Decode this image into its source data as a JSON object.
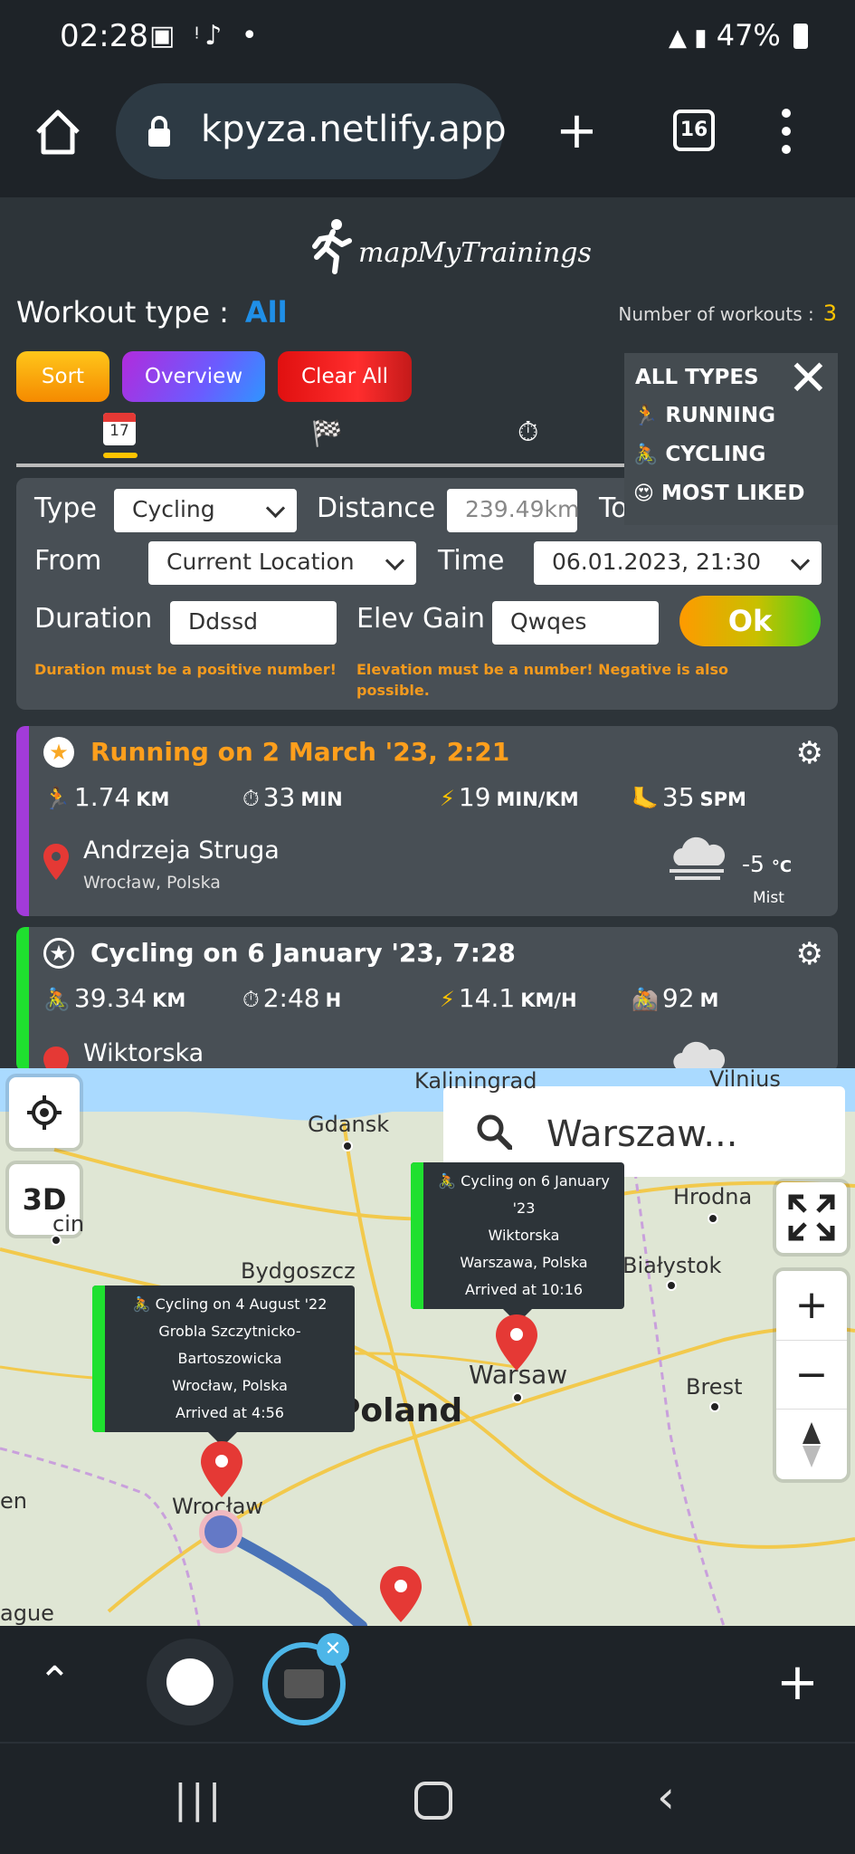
{
  "status_bar": {
    "time": "02:28",
    "battery": "47%"
  },
  "browser": {
    "url": "kpyza.netlify.app",
    "tab_count": "16"
  },
  "app": {
    "logo_text": "mapMyTrainings",
    "workout_type_label": "Workout type :",
    "workout_type_value": "All",
    "workout_count_label": "Number of workouts :",
    "workout_count": "3",
    "buttons": {
      "sort": "Sort",
      "overview": "Overview",
      "clear_all": "Clear All"
    },
    "calendar_day": "17"
  },
  "type_dropdown": {
    "title": "ALL TYPES",
    "items": [
      {
        "icon": "🏃",
        "label": "RUNNING"
      },
      {
        "icon": "🚴",
        "label": "CYCLING"
      },
      {
        "icon": "😍",
        "label": "MOST LIKED"
      }
    ]
  },
  "form": {
    "type_label": "Type",
    "type_value": "Cycling",
    "distance_label": "Distance",
    "distance_value": "239.49km",
    "to_label": "To",
    "from_label": "From",
    "from_value": "Current Location",
    "time_label": "Time",
    "time_value": "06.01.2023, 21:30",
    "duration_label": "Duration",
    "duration_value": "Ddssd",
    "elev_label": "Elev Gain",
    "elev_value": "Qwqes",
    "ok_label": "Ok",
    "duration_error": "Duration must be a positive number!",
    "elev_error_line1": "Elevation must be a number! Negative is also",
    "elev_error_line2": "possible."
  },
  "workouts": [
    {
      "title": "Running on 2 March '23, 2:21",
      "title_color": "#ff9f1c",
      "stripe_color": "#a23bd9",
      "stats": [
        {
          "icon": "🏃",
          "value": "1.74",
          "unit": "KM"
        },
        {
          "icon": "⏱",
          "value": "33",
          "unit": "MIN"
        },
        {
          "icon": "⚡",
          "value": "19",
          "unit": "MIN/KM"
        },
        {
          "icon": "🦶",
          "value": "35",
          "unit": "SPM"
        }
      ],
      "street": "Andrzeja Struga",
      "city": "Wrocław, Polska",
      "temp": "-5",
      "temp_unit": "°C",
      "weather": "Mist"
    },
    {
      "title": "Cycling on 6 January '23, 7:28",
      "title_color": "#ffffff",
      "stripe_color": "#1fe02f",
      "stats": [
        {
          "icon": "🚴",
          "value": "39.34",
          "unit": "KM"
        },
        {
          "icon": "⏱",
          "value": "2:48",
          "unit": "H"
        },
        {
          "icon": "⚡",
          "value": "14.1",
          "unit": "KM/H"
        },
        {
          "icon": "🚵",
          "value": "92",
          "unit": "M"
        }
      ],
      "street": "Wiktorska"
    }
  ],
  "map": {
    "search_text": "Warszaw...",
    "button_3d": "3D",
    "cities": {
      "kaliningrad": "Kaliningrad",
      "vilnius": "Vilnius",
      "gdansk": "Gdansk",
      "hrodna": "Hrodna",
      "szczecin": "cin",
      "bydgoszcz": "Bydgoszcz",
      "bialystok": "Białystok",
      "warsaw": "Warsaw",
      "poland": "Poland",
      "brest": "Brest",
      "wroclaw": "Wrocław",
      "berlin": "en",
      "prague": "ague"
    },
    "popups": [
      {
        "line1": "🚴 Cycling on 6 January '23",
        "line2": "Wiktorska",
        "line3": "Warszawa, Polska",
        "line4": "Arrived at 10:16"
      },
      {
        "line1": "🚴 Cycling on 4 August '22",
        "line2": "Grobla Szczytnicko-Bartoszowicka",
        "line3": "Wrocław, Polska",
        "line4": "Arrived at 4:56"
      }
    ]
  }
}
